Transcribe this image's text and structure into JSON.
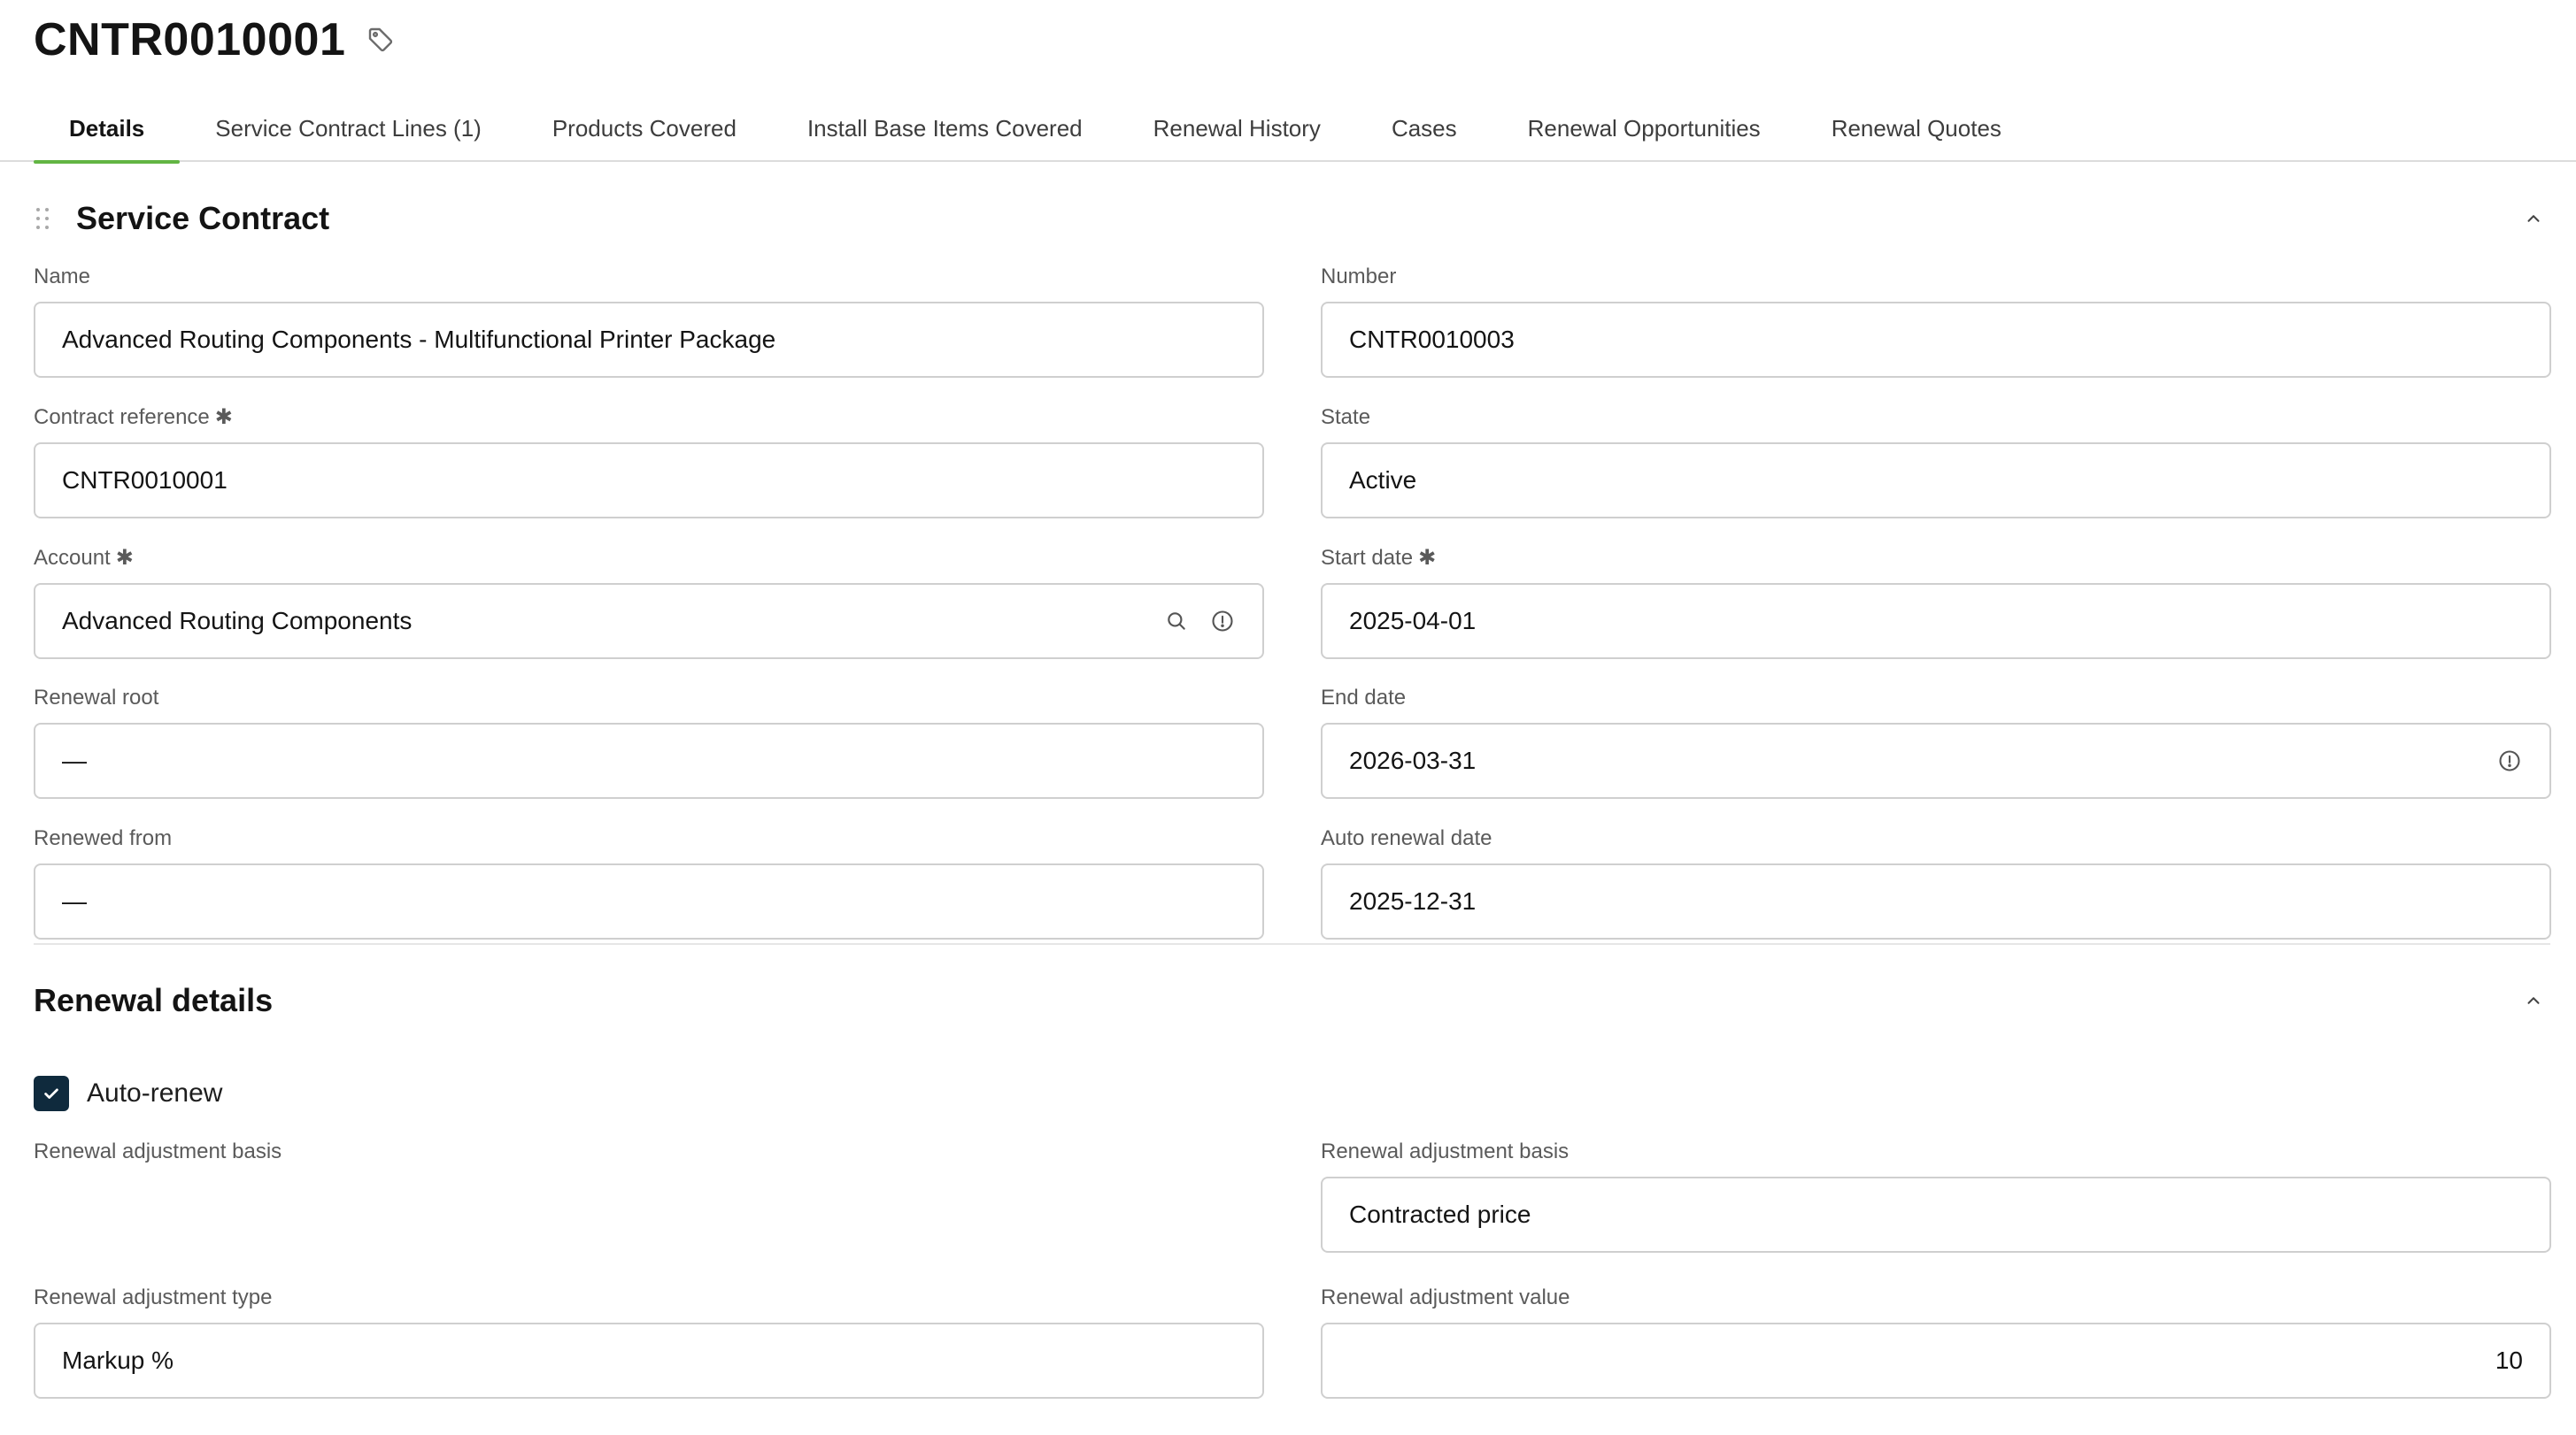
{
  "header": {
    "title": "CNTR0010001",
    "tag_icon": "tag-icon"
  },
  "tabs": [
    {
      "label": "Details",
      "active": true
    },
    {
      "label": "Service Contract Lines (1)",
      "active": false
    },
    {
      "label": "Products Covered",
      "active": false
    },
    {
      "label": "Install Base Items Covered",
      "active": false
    },
    {
      "label": "Renewal History",
      "active": false
    },
    {
      "label": "Cases",
      "active": false
    },
    {
      "label": "Renewal Opportunities",
      "active": false
    },
    {
      "label": "Renewal Quotes",
      "active": false
    }
  ],
  "service_contract": {
    "title": "Service Contract",
    "fields": {
      "name": {
        "label": "Name",
        "value": "Advanced Routing Components - Multifunctional Printer Package"
      },
      "number": {
        "label": "Number",
        "value": "CNTR0010003"
      },
      "contract_reference": {
        "label": "Contract reference",
        "required": "✱",
        "value": "CNTR0010001"
      },
      "state": {
        "label": "State",
        "value": "Active"
      },
      "account": {
        "label": "Account",
        "required": "✱",
        "value": "Advanced Routing Components"
      },
      "start_date": {
        "label": "Start date",
        "required": "✱",
        "value": "2025-04-01"
      },
      "renewal_root": {
        "label": "Renewal root",
        "value": "—"
      },
      "end_date": {
        "label": "End date",
        "value": "2026-03-31"
      },
      "renewed_from": {
        "label": "Renewed from",
        "value": "—"
      },
      "auto_renewal_date": {
        "label": "Auto renewal date",
        "value": "2025-12-31"
      }
    }
  },
  "renewal_details": {
    "title": "Renewal details",
    "auto_renew": {
      "label": "Auto-renew",
      "checked": true
    },
    "fields": {
      "adjustment_basis_left": {
        "label": "Renewal adjustment basis"
      },
      "adjustment_basis_right": {
        "label": "Renewal adjustment basis",
        "value": "Contracted price"
      },
      "adjustment_type": {
        "label": "Renewal adjustment type",
        "value": "Markup %"
      },
      "adjustment_value": {
        "label": "Renewal adjustment value",
        "value": "10"
      }
    }
  },
  "colors": {
    "active_tab_underline": "#62b543",
    "checkbox_fill": "#0f2a3d",
    "input_border": "#cfcfcf"
  }
}
